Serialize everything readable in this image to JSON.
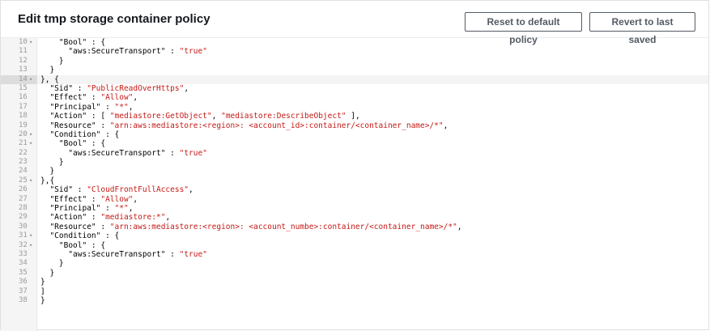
{
  "header": {
    "title": "Edit tmp storage container policy",
    "reset_label": "Reset to default policy",
    "revert_label": "Revert to last saved"
  },
  "editor": {
    "active_line": 14,
    "lines": [
      {
        "n": "10",
        "fold": true,
        "tokens": [
          {
            "t": "    \"Bool\" : {"
          }
        ]
      },
      {
        "n": "11",
        "fold": false,
        "tokens": [
          {
            "t": "      \"aws:SecureTransport\" : "
          },
          {
            "t": "\"true\"",
            "s": 1
          }
        ]
      },
      {
        "n": "12",
        "fold": false,
        "tokens": [
          {
            "t": "    }"
          }
        ]
      },
      {
        "n": "13",
        "fold": false,
        "tokens": [
          {
            "t": "  }"
          }
        ]
      },
      {
        "n": "14",
        "fold": true,
        "tokens": [
          {
            "t": "}, {"
          }
        ]
      },
      {
        "n": "15",
        "fold": false,
        "tokens": [
          {
            "t": "  \"Sid\" : "
          },
          {
            "t": "\"PublicReadOverHttps\"",
            "s": 1
          },
          {
            "t": ","
          }
        ]
      },
      {
        "n": "16",
        "fold": false,
        "tokens": [
          {
            "t": "  \"Effect\" : "
          },
          {
            "t": "\"Allow\"",
            "s": 1
          },
          {
            "t": ","
          }
        ]
      },
      {
        "n": "17",
        "fold": false,
        "tokens": [
          {
            "t": "  \"Principal\" : "
          },
          {
            "t": "\"*\"",
            "s": 1
          },
          {
            "t": ","
          }
        ]
      },
      {
        "n": "18",
        "fold": false,
        "tokens": [
          {
            "t": "  \"Action\" : [ "
          },
          {
            "t": "\"mediastore:GetObject\"",
            "s": 1
          },
          {
            "t": ", "
          },
          {
            "t": "\"mediastore:DescribeObject\"",
            "s": 1
          },
          {
            "t": " ],"
          }
        ]
      },
      {
        "n": "19",
        "fold": false,
        "tokens": [
          {
            "t": "  \"Resource\" : "
          },
          {
            "t": "\"arn:aws:mediastore:<region>: <account_id>:container/<container_name>/*\"",
            "s": 1
          },
          {
            "t": ","
          }
        ]
      },
      {
        "n": "20",
        "fold": true,
        "tokens": [
          {
            "t": "  \"Condition\" : {"
          }
        ]
      },
      {
        "n": "21",
        "fold": true,
        "tokens": [
          {
            "t": "    \"Bool\" : {"
          }
        ]
      },
      {
        "n": "22",
        "fold": false,
        "tokens": [
          {
            "t": "      \"aws:SecureTransport\" : "
          },
          {
            "t": "\"true\"",
            "s": 1
          }
        ]
      },
      {
        "n": "23",
        "fold": false,
        "tokens": [
          {
            "t": "    }"
          }
        ]
      },
      {
        "n": "24",
        "fold": false,
        "tokens": [
          {
            "t": "  }"
          }
        ]
      },
      {
        "n": "25",
        "fold": true,
        "tokens": [
          {
            "t": "},{"
          }
        ]
      },
      {
        "n": "26",
        "fold": false,
        "tokens": [
          {
            "t": "  \"Sid\" : "
          },
          {
            "t": "\"CloudFrontFullAccess\"",
            "s": 1
          },
          {
            "t": ","
          }
        ]
      },
      {
        "n": "27",
        "fold": false,
        "tokens": [
          {
            "t": "  \"Effect\" : "
          },
          {
            "t": "\"Allow\"",
            "s": 1
          },
          {
            "t": ","
          }
        ]
      },
      {
        "n": "28",
        "fold": false,
        "tokens": [
          {
            "t": "  \"Principal\" : "
          },
          {
            "t": "\"*\"",
            "s": 1
          },
          {
            "t": ","
          }
        ]
      },
      {
        "n": "29",
        "fold": false,
        "tokens": [
          {
            "t": "  \"Action\" : "
          },
          {
            "t": "\"mediastore:*\"",
            "s": 1
          },
          {
            "t": ","
          }
        ]
      },
      {
        "n": "30",
        "fold": false,
        "tokens": [
          {
            "t": "  \"Resource\" : "
          },
          {
            "t": "\"arn:aws:mediastore:<region>: <account_numbe>:container/<container_name>/*\"",
            "s": 1
          },
          {
            "t": ","
          }
        ]
      },
      {
        "n": "31",
        "fold": true,
        "tokens": [
          {
            "t": "  \"Condition\" : {"
          }
        ]
      },
      {
        "n": "32",
        "fold": true,
        "tokens": [
          {
            "t": "    \"Bool\" : {"
          }
        ]
      },
      {
        "n": "33",
        "fold": false,
        "tokens": [
          {
            "t": "      \"aws:SecureTransport\" : "
          },
          {
            "t": "\"true\"",
            "s": 1
          }
        ]
      },
      {
        "n": "34",
        "fold": false,
        "tokens": [
          {
            "t": "    }"
          }
        ]
      },
      {
        "n": "35",
        "fold": false,
        "tokens": [
          {
            "t": "  }"
          }
        ]
      },
      {
        "n": "36",
        "fold": false,
        "tokens": [
          {
            "t": "}"
          }
        ]
      },
      {
        "n": "37",
        "fold": false,
        "tokens": [
          {
            "t": "]"
          }
        ]
      },
      {
        "n": "38",
        "fold": false,
        "tokens": [
          {
            "t": "}"
          }
        ]
      }
    ]
  }
}
